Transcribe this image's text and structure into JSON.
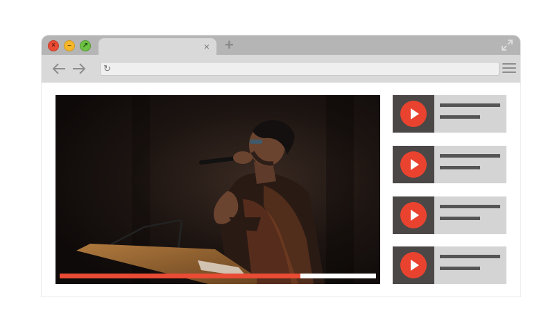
{
  "browser": {
    "tab_close_glyph": "×",
    "new_tab_glyph": "+",
    "reload_glyph": "↻",
    "address_value": "",
    "icons": [
      "close-window-icon",
      "minimize-window-icon",
      "maximize-window-icon",
      "fullscreen-icon",
      "back-arrow-icon",
      "forward-arrow-icon",
      "reload-icon",
      "hamburger-menu-icon"
    ]
  },
  "player": {
    "progress": 0.76,
    "colors": {
      "progress": "#e94b35",
      "track": "#ffffff"
    }
  },
  "playlist": {
    "items": [
      {
        "icon": "play-icon"
      },
      {
        "icon": "play-icon"
      },
      {
        "icon": "play-icon"
      },
      {
        "icon": "play-icon"
      }
    ],
    "colors": {
      "play": "#e9432f",
      "thumb": "#4b4746",
      "card": "#d4d4d4"
    }
  }
}
